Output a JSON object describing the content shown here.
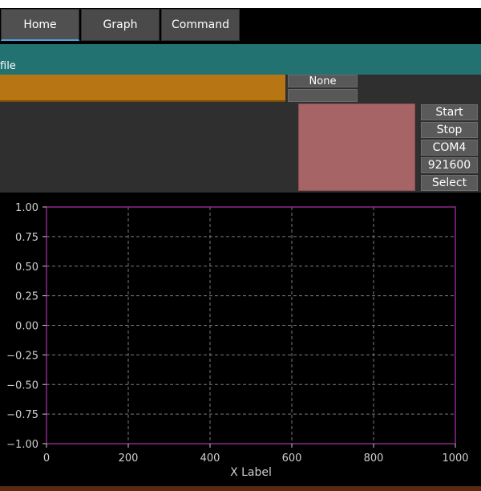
{
  "tabs": [
    {
      "label": "Home",
      "active": true
    },
    {
      "label": "Graph",
      "active": false
    },
    {
      "label": "Command",
      "active": false
    }
  ],
  "file_label": "file",
  "none_button": "None",
  "blank_button": "",
  "controls": {
    "start": "Start",
    "stop": "Stop",
    "port": "COM4",
    "baud": "921600",
    "select": "Select"
  },
  "colors": {
    "accent": "#4aa3df",
    "file_band": "#227272",
    "orange_bar": "#b87513",
    "pink_box": "#a76467",
    "plot_frame": "#8a2a8a"
  },
  "chart_data": {
    "type": "line",
    "series": [],
    "xlim": [
      0,
      1000
    ],
    "ylim": [
      -1.0,
      1.0
    ],
    "xticks": [
      "0",
      "200",
      "400",
      "600",
      "800",
      "1000"
    ],
    "yticks": [
      "1.00",
      "0.75",
      "0.50",
      "0.25",
      "0.00",
      "−0.25",
      "−0.50",
      "−0.75",
      "−1.00"
    ],
    "xlabel": "X Label",
    "grid": true
  }
}
